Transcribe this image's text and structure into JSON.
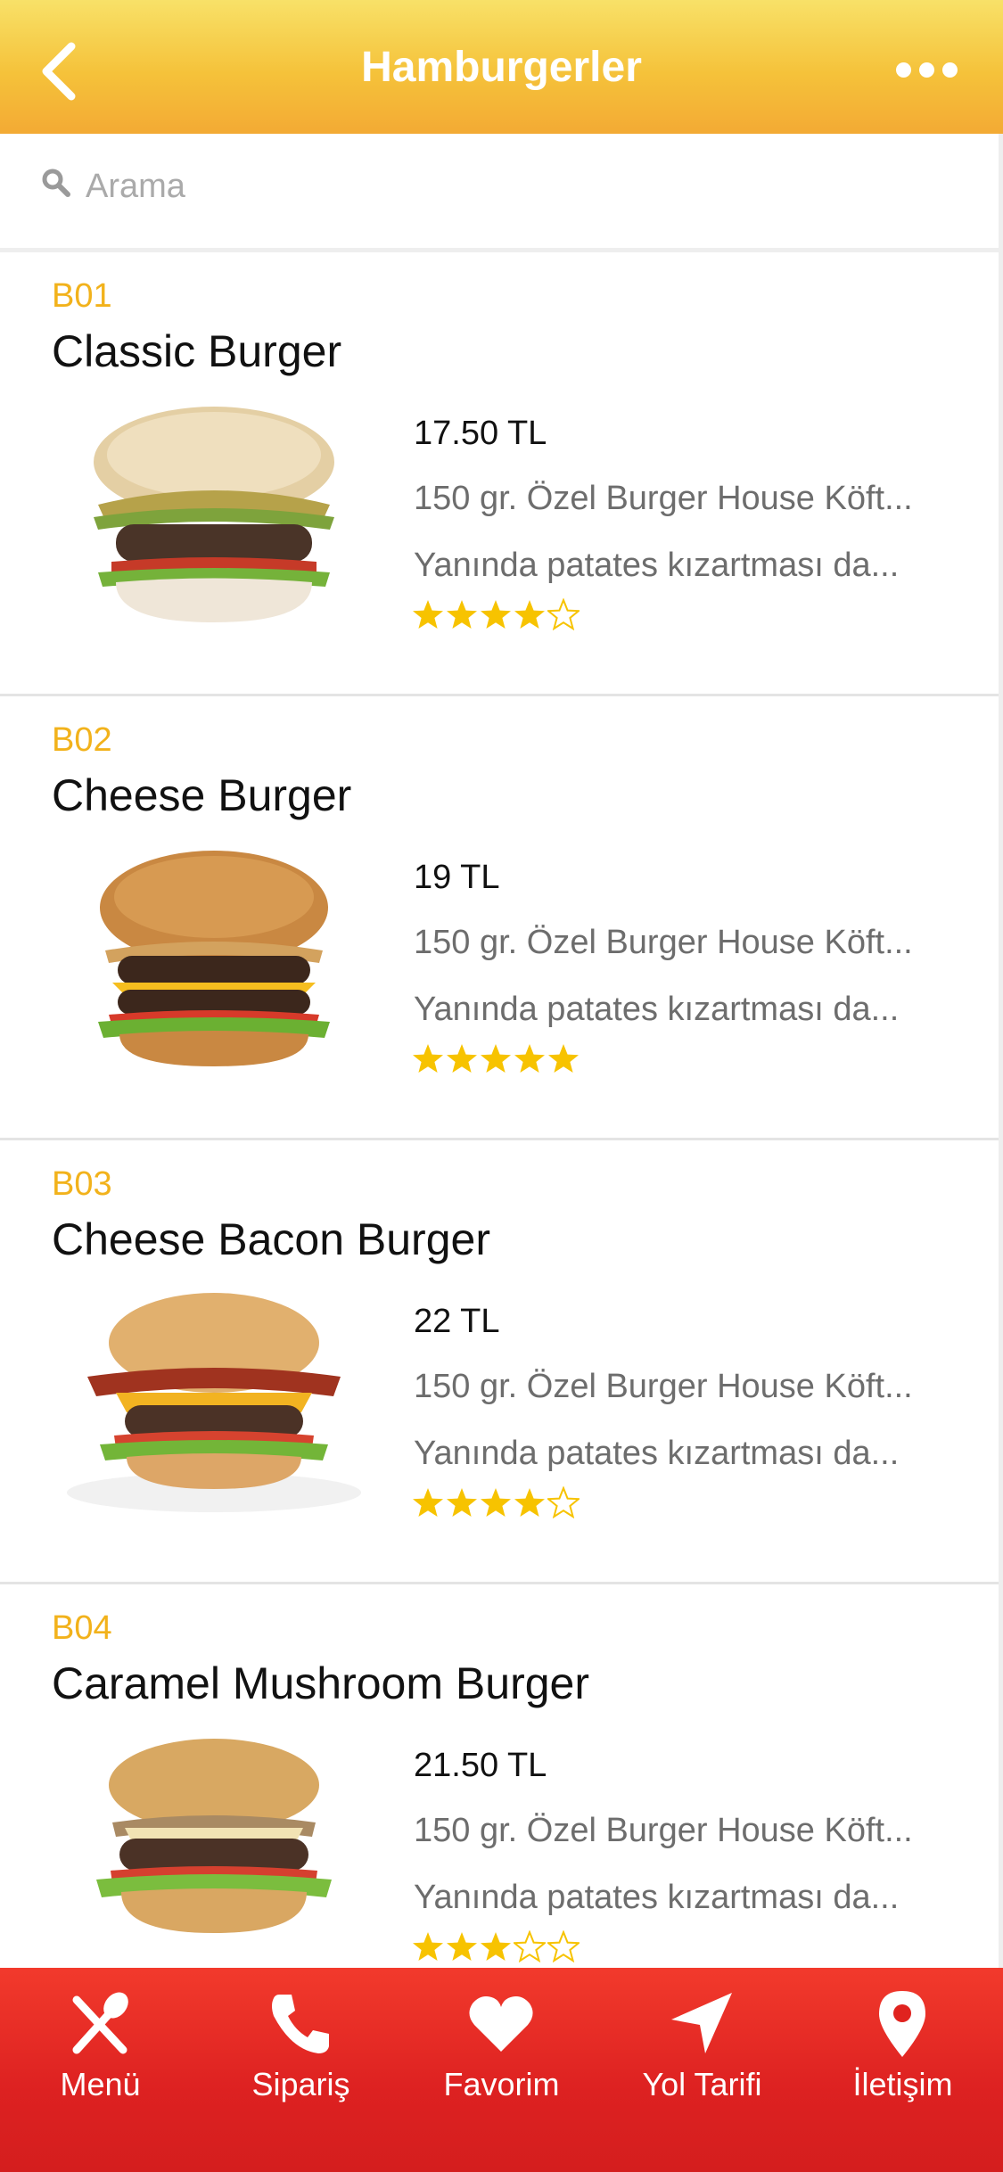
{
  "header": {
    "title": "Hamburgerler",
    "back_icon": "chevron-left-icon",
    "more_icon": "more-dots-icon"
  },
  "search": {
    "placeholder": "Arama",
    "icon": "search-icon"
  },
  "items": [
    {
      "code": "B01",
      "name": "Classic Burger",
      "price": "17.50 TL",
      "desc1": "150 gr. Özel Burger House Köft...",
      "desc2": "Yanında patates kızartması da...",
      "rating": 4
    },
    {
      "code": "B02",
      "name": "Cheese Burger",
      "price": "19 TL",
      "desc1": "150 gr. Özel Burger House Köft...",
      "desc2": "Yanında patates kızartması da...",
      "rating": 5
    },
    {
      "code": "B03",
      "name": "Cheese Bacon Burger",
      "price": "22 TL",
      "desc1": "150 gr. Özel Burger House Köft...",
      "desc2": "Yanında patates kızartması da...",
      "rating": 4
    },
    {
      "code": "B04",
      "name": "Caramel Mushroom Burger",
      "price": "21.50 TL",
      "desc1": "150 gr. Özel Burger House Köft...",
      "desc2": "Yanında patates kızartması da...",
      "rating": 3
    }
  ],
  "tabs": [
    {
      "label": "Menü",
      "icon": "fork-spoon-icon"
    },
    {
      "label": "Sipariş",
      "icon": "phone-icon"
    },
    {
      "label": "Favorim",
      "icon": "heart-icon"
    },
    {
      "label": "Yol Tarifi",
      "icon": "navigation-arrow-icon"
    },
    {
      "label": "İletişim",
      "icon": "map-pin-icon"
    }
  ],
  "colors": {
    "header_accent": "#f5c23a",
    "code_color": "#f2b21b",
    "star_color": "#f7c300",
    "tabbar": "#e0231f"
  }
}
